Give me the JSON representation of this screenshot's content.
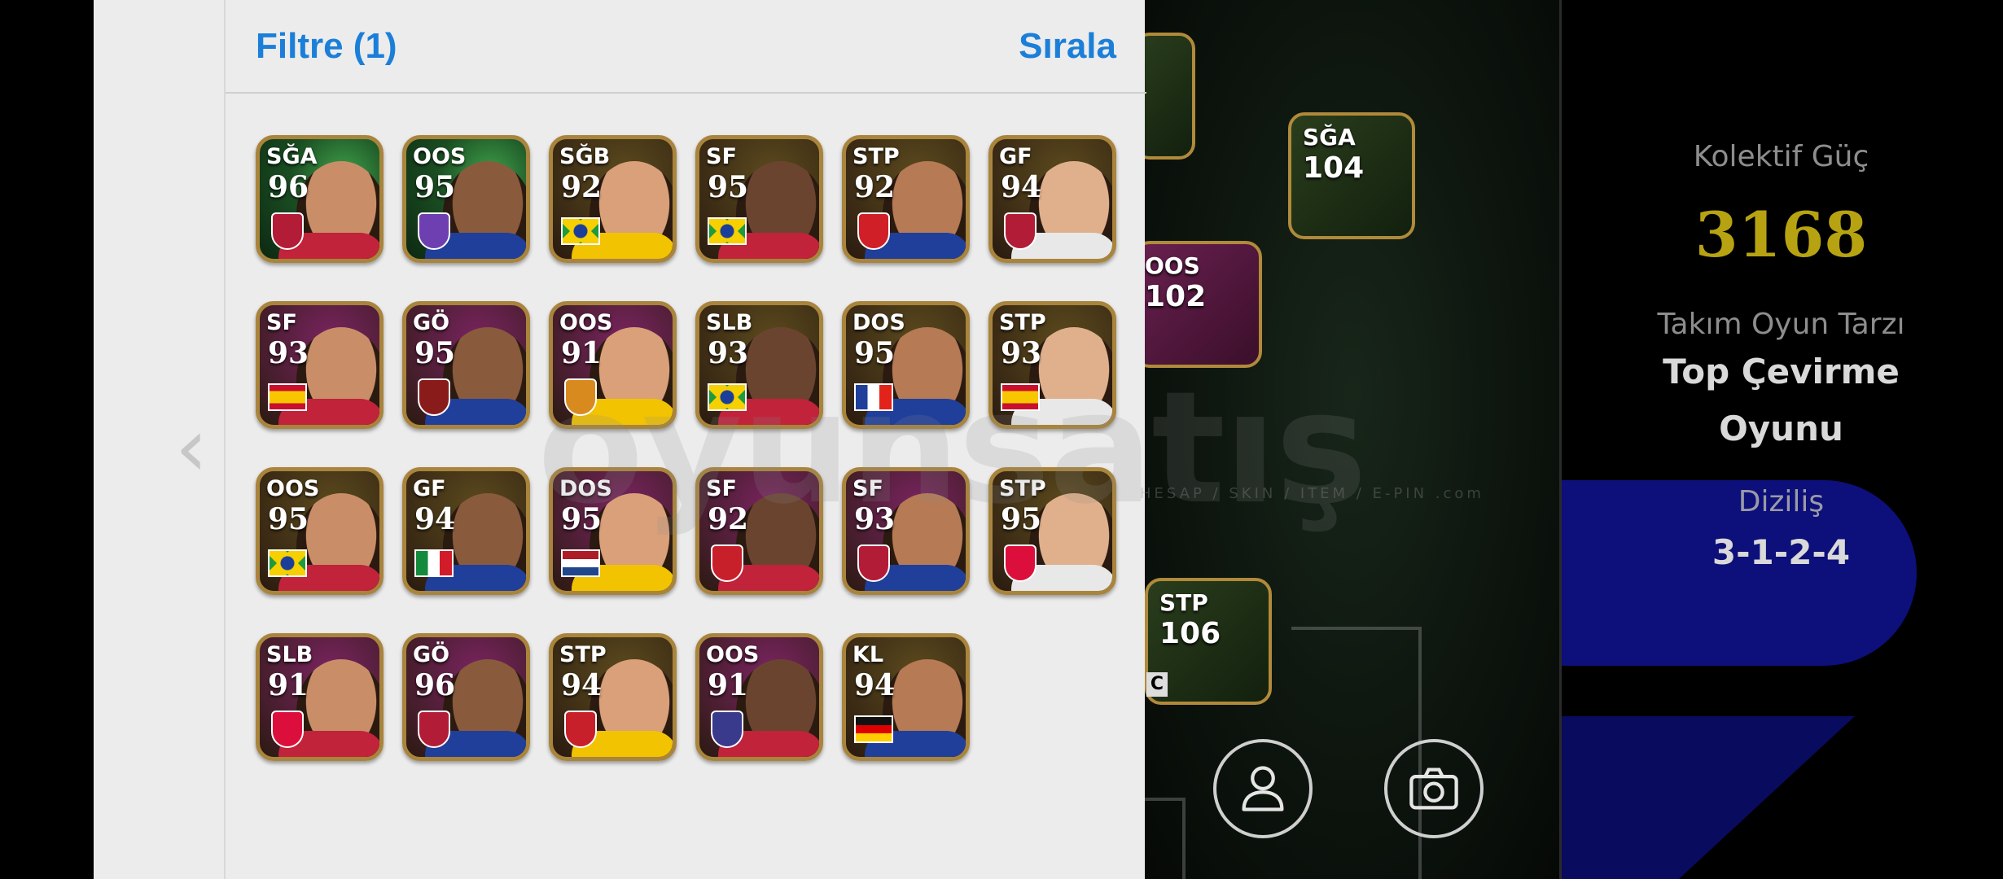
{
  "panel": {
    "filter_label": "Filtre (1)",
    "sort_label": "Sırala",
    "back_glyph": "‹"
  },
  "players": [
    {
      "pos": "SĞA",
      "ovr": "96",
      "badge": "crest",
      "badge_color": "#b31c36",
      "bg": "#1f5a2a",
      "epic": true
    },
    {
      "pos": "OOS",
      "ovr": "95",
      "badge": "crest",
      "badge_color": "#6e3fb0",
      "bg": "#1f5a2a",
      "epic": true
    },
    {
      "pos": "SĞB",
      "ovr": "92",
      "badge": "flag-brazil",
      "bg": "#5b4a1d"
    },
    {
      "pos": "SF",
      "ovr": "95",
      "badge": "flag-brazil",
      "bg": "#5b4a1d"
    },
    {
      "pos": "STP",
      "ovr": "92",
      "badge": "crest",
      "badge_color": "#d01f27",
      "bg": "#5b4a1d"
    },
    {
      "pos": "GF",
      "ovr": "94",
      "badge": "crest",
      "badge_color": "#b31c36",
      "bg": "#5b4a1d"
    },
    {
      "pos": "SF",
      "ovr": "93",
      "badge": "flag-spain",
      "bg": "#7a2460"
    },
    {
      "pos": "GÖ",
      "ovr": "95",
      "badge": "crest",
      "badge_color": "#8a1b1b",
      "bg": "#7a2460"
    },
    {
      "pos": "OOS",
      "ovr": "91",
      "badge": "crest",
      "badge_color": "#d98a1e",
      "bg": "#7a2460"
    },
    {
      "pos": "SLB",
      "ovr": "93",
      "badge": "flag-brazil",
      "bg": "#5b4a1d"
    },
    {
      "pos": "DOS",
      "ovr": "95",
      "badge": "flag-france",
      "bg": "#5b4a1d"
    },
    {
      "pos": "STP",
      "ovr": "93",
      "badge": "flag-spain",
      "bg": "#5b4a1d"
    },
    {
      "pos": "OOS",
      "ovr": "95",
      "badge": "flag-brazil",
      "bg": "#5b4a1d"
    },
    {
      "pos": "GF",
      "ovr": "94",
      "badge": "flag-italy",
      "bg": "#5b4a1d"
    },
    {
      "pos": "DOS",
      "ovr": "95",
      "badge": "flag-netherlands",
      "bg": "#7a2460"
    },
    {
      "pos": "SF",
      "ovr": "92",
      "badge": "crest",
      "badge_color": "#c8202a",
      "bg": "#7a2460"
    },
    {
      "pos": "SF",
      "ovr": "93",
      "badge": "crest",
      "badge_color": "#b31c36",
      "bg": "#7a2460"
    },
    {
      "pos": "STP",
      "ovr": "95",
      "badge": "crest",
      "badge_color": "#dc0f3c",
      "bg": "#5b4a1d"
    },
    {
      "pos": "SLB",
      "ovr": "91",
      "badge": "crest",
      "badge_color": "#dc0f3c",
      "bg": "#7a2460"
    },
    {
      "pos": "GÖ",
      "ovr": "96",
      "badge": "crest",
      "badge_color": "#b31c36",
      "bg": "#7a2460"
    },
    {
      "pos": "STP",
      "ovr": "94",
      "badge": "crest",
      "badge_color": "#c8202a",
      "bg": "#5b4a1d"
    },
    {
      "pos": "OOS",
      "ovr": "91",
      "badge": "crest",
      "badge_color": "#3a3a8c",
      "bg": "#7a2460"
    },
    {
      "pos": "KL",
      "ovr": "94",
      "badge": "flag-germany",
      "bg": "#5b4a1d"
    }
  ],
  "pitch_cards": [
    {
      "pos": "",
      "ovr": ""
    },
    {
      "pos": "SĞA",
      "ovr": "104"
    },
    {
      "pos": "OOS",
      "ovr": "102"
    },
    {
      "pos": "STP",
      "ovr": "106"
    }
  ],
  "captain_badge": "C",
  "watermark": {
    "main": "oyunsatış",
    "sub": "HESAP / SKIN / ITEM / E-PIN .com"
  },
  "stats": {
    "collective_label": "Kolektif Güç",
    "collective_value": "3168",
    "playstyle_label": "Takım Oyun Tarzı",
    "playstyle_line1": "Top Çevirme",
    "playstyle_line2": "Oyunu",
    "formation_label": "Diziliş",
    "formation_value": "3-1-2-4"
  },
  "icons": {
    "profile": "person-icon",
    "camera": "camera-icon"
  },
  "colors": {
    "accent_blue": "#1b7fd9",
    "gold_value": "#b7a312",
    "formation_pill": "#0d0f7a"
  }
}
